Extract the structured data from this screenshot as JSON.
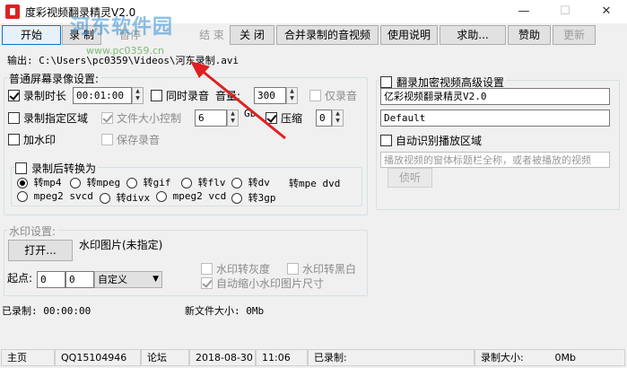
{
  "window": {
    "title": "度彩视频翻录精灵V2.0",
    "min": "—",
    "max": "☐",
    "close": "✕"
  },
  "watermark": {
    "text": "河东软件园",
    "url": "www.pc0359.cn"
  },
  "toolbar": {
    "buttons": [
      "开始",
      "录 制",
      "暂停",
      "结 束",
      "关 闭",
      "合并录制的音视频",
      "使用说明",
      "求助...",
      "赞助",
      "更新"
    ]
  },
  "output": {
    "label": "输出:",
    "path": "C:\\Users\\pc0359\\Videos\\河东录制.avi"
  },
  "normal": {
    "title": "普通屏幕录像设置:",
    "record_duration": "录制时长",
    "duration_value": "00:01:00",
    "sync_audio": "同时录音",
    "volume_label": "音量:",
    "volume_value": "300",
    "audio_only": "仅录音",
    "record_region": "录制指定区域",
    "file_size_control": "文件大小控制",
    "size_value": "6",
    "size_unit": "Gb",
    "compress": "压缩",
    "compress_value": "0",
    "add_watermark": "加水印",
    "save_audio": "保存录音"
  },
  "convert": {
    "title": "录制后转换为",
    "options": [
      "转mp4",
      "转mpeg",
      "转gif",
      "转flv",
      "转dv",
      "转mpe dvd",
      "mpeg2 svcd",
      "转divx",
      "mpeg2 vcd",
      "转3gp"
    ]
  },
  "watermark_settings": {
    "title": "水印设置:",
    "open_button": "打开...",
    "image_status": "水印图片(未指定)",
    "origin_label": "起点:",
    "origin_x": "0",
    "origin_y": "0",
    "position_mode": "自定义",
    "to_gray": "水印转灰度",
    "to_bw": "水印转黑白",
    "auto_shrink": "自动缩小水印图片尺寸"
  },
  "advanced": {
    "title": "翻录加密视频高级设置",
    "name_value": "亿彩视频翻录精灵V2.0",
    "default_value": "Default",
    "auto_detect": "自动识别播放区域",
    "window_hint": "播放视频的窗体标题栏全称，或者被播放的视频",
    "detect_button": "侦听"
  },
  "progress": {
    "recorded_label": "已录制:",
    "recorded_value": "00:00:00",
    "new_size_label": "新文件大小:",
    "new_size_value": "0Mb"
  },
  "statusbar": {
    "home": "主页",
    "qq": "QQ15104946",
    "forum": "论坛",
    "date": "2018-08-30",
    "time": "11:06",
    "recorded_label": "已录制:",
    "recorded_value": "",
    "size_label": "录制大小:",
    "size_value": "0Mb"
  }
}
